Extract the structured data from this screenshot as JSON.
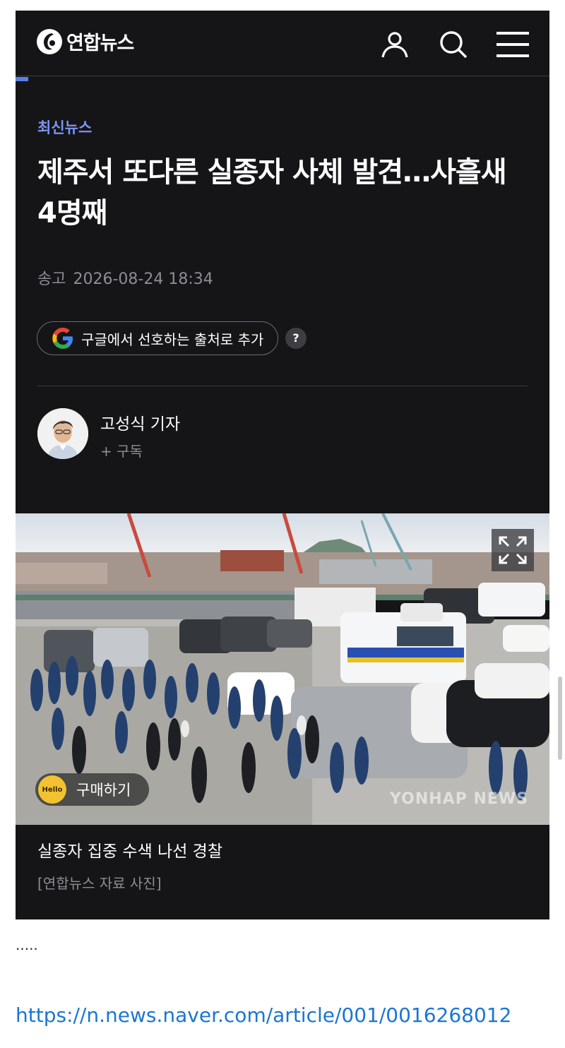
{
  "header": {
    "logo_text": "연합뉴스",
    "icons": [
      "user-icon",
      "search-icon",
      "menu-icon"
    ]
  },
  "article": {
    "section": "최신뉴스",
    "headline": "제주서 또다른 실종자 사체 발견…사흘새 4명째",
    "date_label": "송고",
    "date": "2026-08-24 18:34",
    "google_pref": "구글에서 선호하는 출처로 추가",
    "help": "?",
    "reporter": "고성식 기자",
    "subscribe": "+ 구독",
    "photo": {
      "buy_badge": "Hello",
      "buy": "구매하기",
      "watermark": "YONHAP NEWS",
      "caption": "실종자 집중 수색 나선 경찰",
      "credit": "[연합뉴스 자료 사진]"
    }
  },
  "body_text": ".....",
  "link": "https://n.news.naver.com/article/001/0016268012",
  "colors": {
    "background": "#151518",
    "accent": "#7b95f0",
    "link": "#1a76d2"
  }
}
